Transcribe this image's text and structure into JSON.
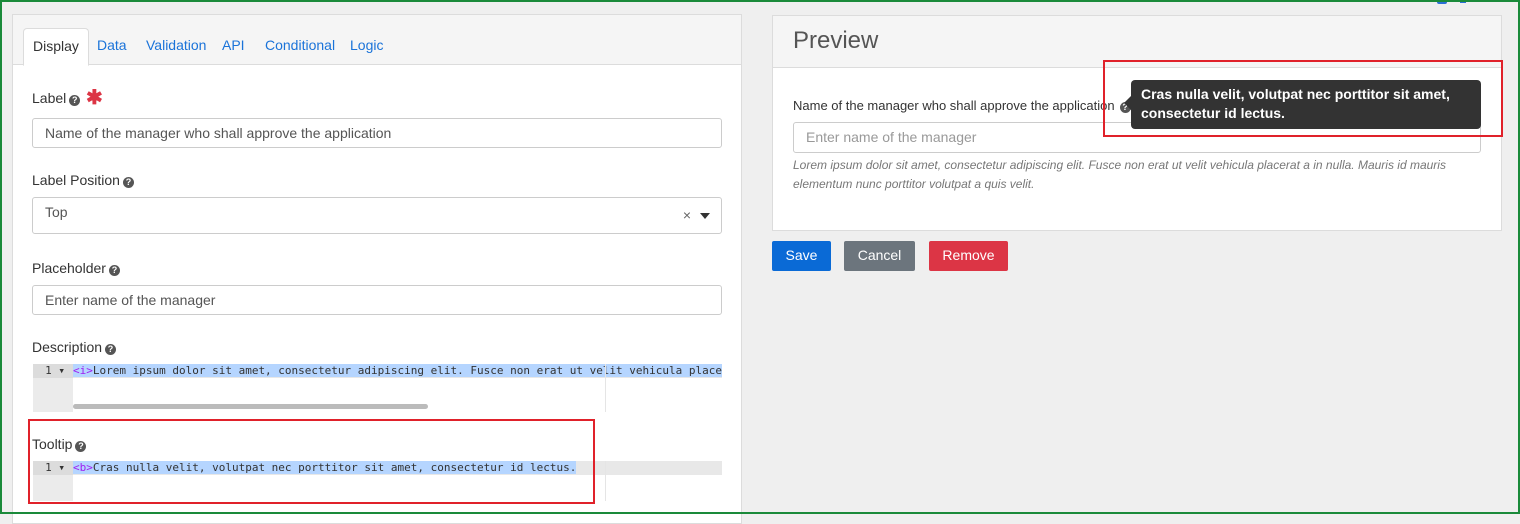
{
  "tabs": [
    "Display",
    "Data",
    "Validation",
    "API",
    "Conditional",
    "Logic"
  ],
  "fields": {
    "label": {
      "label": "Label",
      "value": "Name of the manager who shall approve the application"
    },
    "label_position": {
      "label": "Label Position",
      "value": "Top",
      "clear": "×"
    },
    "placeholder": {
      "label": "Placeholder",
      "value": "Enter name of the manager"
    },
    "description": {
      "label": "Description",
      "line_no": "1",
      "tag": "<i>",
      "code": "Lorem ipsum dolor sit amet, consectetur adipiscing elit. Fusce non erat ut velit vehicula place"
    },
    "tooltip": {
      "label": "Tooltip",
      "line_no": "1",
      "tag": "<b>",
      "code": "Cras nulla velit, volutpat nec porttitor sit amet, consectetur id lectus."
    }
  },
  "help_glyph": "?",
  "required_glyph": "✱",
  "preview": {
    "title": "Preview",
    "field_label": "Name of the manager who shall approve the application",
    "placeholder": "Enter name of the manager",
    "description": "Lorem ipsum dolor sit amet, consectetur adipiscing elit. Fusce non erat ut velit vehicula placerat a in nulla. Mauris id mauris elementum nunc porttitor volutpat a quis velit.",
    "tooltip": "Cras nulla velit, volutpat nec porttitor sit amet, consectetur id lectus."
  },
  "buttons": {
    "save": "Save",
    "cancel": "Cancel",
    "remove": "Remove"
  },
  "colors": {
    "save": "#0a6ad6",
    "cancel": "#6c757d",
    "remove": "#dc3545",
    "highlight_box": "#e0212a"
  }
}
